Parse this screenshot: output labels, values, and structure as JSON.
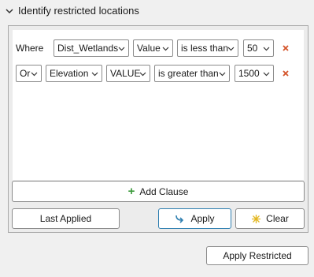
{
  "section": {
    "title": "Identify restricted locations",
    "icon": "chevron-down-icon"
  },
  "clauses": [
    {
      "connector": "Where",
      "field": "Dist_Wetlands",
      "source": "Value",
      "operator": "is less than",
      "value": "50"
    },
    {
      "connector": "Or",
      "field": "Elevation",
      "source": "VALUE",
      "operator": "is greater than",
      "value": "1500"
    }
  ],
  "buttons": {
    "add_clause": "Add Clause",
    "last_applied": "Last Applied",
    "apply": "Apply",
    "clear": "Clear",
    "apply_restricted": "Apply Restricted"
  },
  "colors": {
    "remove": "#d4542a",
    "add": "#3c9a3c",
    "accent": "#2f7fb0"
  }
}
